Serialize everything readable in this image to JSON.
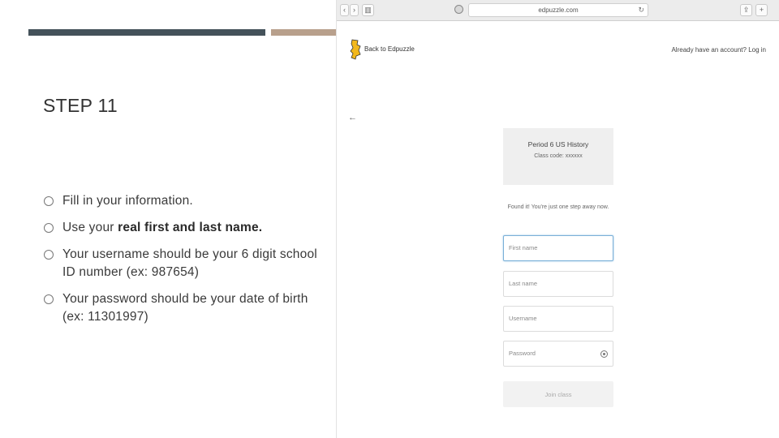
{
  "slide": {
    "title": "STEP 11",
    "bullets": [
      {
        "pre": "Fill in your information.",
        "bold": "",
        "post": ""
      },
      {
        "pre": "Use your ",
        "bold": "real first and last name.",
        "post": ""
      },
      {
        "pre": "Your username should be your 6 digit school ID number (ex: 987654)",
        "bold": "",
        "post": ""
      },
      {
        "pre": "Your password should be your date of birth (ex: 11301997)",
        "bold": "",
        "post": ""
      }
    ],
    "colors": {
      "bar_dark": "#44525a",
      "bar_tan": "#b8a08c"
    }
  },
  "browser": {
    "url": "edpuzzle.com",
    "back_link": "Back to Edpuzzle",
    "login_link": "Already have an account? Log in",
    "class_card": {
      "name": "Period 6 US History",
      "sub": "",
      "code": "Class code: xxxxxx"
    },
    "found_text": "Found it! You're just one step away now.",
    "fields": {
      "first_name": "First name",
      "last_name": "Last name",
      "username": "Username",
      "password": "Password"
    },
    "join_button": "Join class",
    "icons": {
      "logo": "edpuzzle-logo",
      "back": "back-arrow-icon",
      "password_toggle": "eye-icon"
    }
  }
}
